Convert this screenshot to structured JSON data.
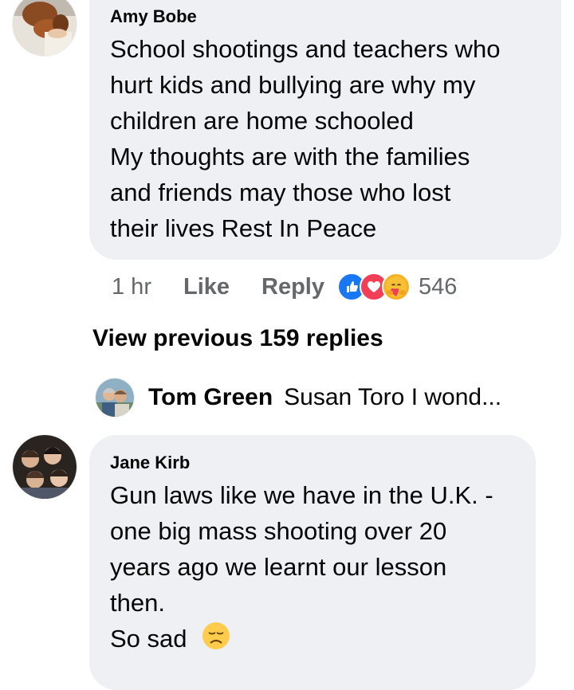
{
  "comments": [
    {
      "author": "Amy Bobe",
      "lines": [
        "School shootings and teachers who",
        "hurt kids and bullying are why my",
        "children are home schooled",
        "My thoughts are with the families",
        "and friends may those who lost",
        "their lives Rest In Peace"
      ],
      "time": "1 hr",
      "like_label": "Like",
      "reply_label": "Reply",
      "reactions": [
        "like-reaction-icon",
        "love-reaction-icon",
        "care-reaction-icon"
      ],
      "reaction_count": "546"
    },
    {
      "author": "Jane Kirb",
      "lines": [
        "Gun laws like we have in the U.K. -",
        "one big mass shooting over 20",
        "years ago we learnt our lesson",
        "then.",
        "So sad"
      ],
      "emoji": "disappointed-face-icon"
    }
  ],
  "view_previous": "View previous 159 replies",
  "reply_preview": {
    "name": "Tom Green",
    "text": "Susan Toro I wond..."
  },
  "colors": {
    "bubble": "#eef0f3",
    "secondary_text": "#65676b",
    "like_blue": "#1877f2",
    "love_red": "#f33e58",
    "care_yellow": "#f7b125"
  }
}
